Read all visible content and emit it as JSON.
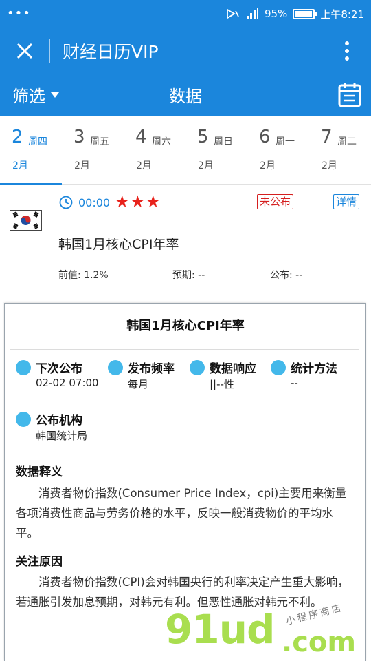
{
  "status_bar": {
    "menu": "•••",
    "battery": "95%",
    "battery_fraction": 0.95,
    "time": "上午8:21"
  },
  "app_bar": {
    "title": "财经日历VIP"
  },
  "filter_bar": {
    "filter_label": "筛选",
    "center_label": "数据"
  },
  "dates": [
    {
      "day": "2",
      "weekday": "周四",
      "month": "2月",
      "active": true
    },
    {
      "day": "3",
      "weekday": "周五",
      "month": "2月",
      "active": false
    },
    {
      "day": "4",
      "weekday": "周六",
      "month": "2月",
      "active": false
    },
    {
      "day": "5",
      "weekday": "周日",
      "month": "2月",
      "active": false
    },
    {
      "day": "6",
      "weekday": "周一",
      "month": "2月",
      "active": false
    },
    {
      "day": "7",
      "weekday": "周二",
      "month": "2月",
      "active": false
    }
  ],
  "event": {
    "time": "00:00",
    "stars": "★★★",
    "star_count": 3,
    "status": "未公布",
    "detail_label": "详情",
    "title": "韩国1月核心CPI年率",
    "previous": "前值: 1.2%",
    "forecast": "预期: --",
    "actual": "公布: --"
  },
  "panel": {
    "title": "韩国1月核心CPI年率",
    "info": [
      {
        "label": "下次公布",
        "value": "02-02 07:00"
      },
      {
        "label": "发布频率",
        "value": "每月"
      },
      {
        "label": "数据响应",
        "value": "||--性"
      },
      {
        "label": "统计方法",
        "value": "--"
      },
      {
        "label": "公布机构",
        "value": "韩国统计局"
      }
    ],
    "section1": {
      "heading": "数据释义",
      "body": "消费者物价指数(Consumer Price Index，cpi)主要用来衡量各项消费性商品与劳务价格的水平，反映一般消费物价的平均水平。"
    },
    "section2": {
      "heading": "关注原因",
      "body": "消费者物价指数(CPI)会对韩国央行的利率决定产生重大影响，若通胀引发加息预期，对韩元有利。但恶性通胀对韩元不利。"
    }
  },
  "watermark": {
    "brand": "91ud",
    "suffix": ".com",
    "tagline": "小程序商店"
  },
  "colors": {
    "primary": "#1b86dc",
    "star": "#e8221b",
    "dot": "#43b8ea",
    "badge_red": "#d51f1f"
  }
}
